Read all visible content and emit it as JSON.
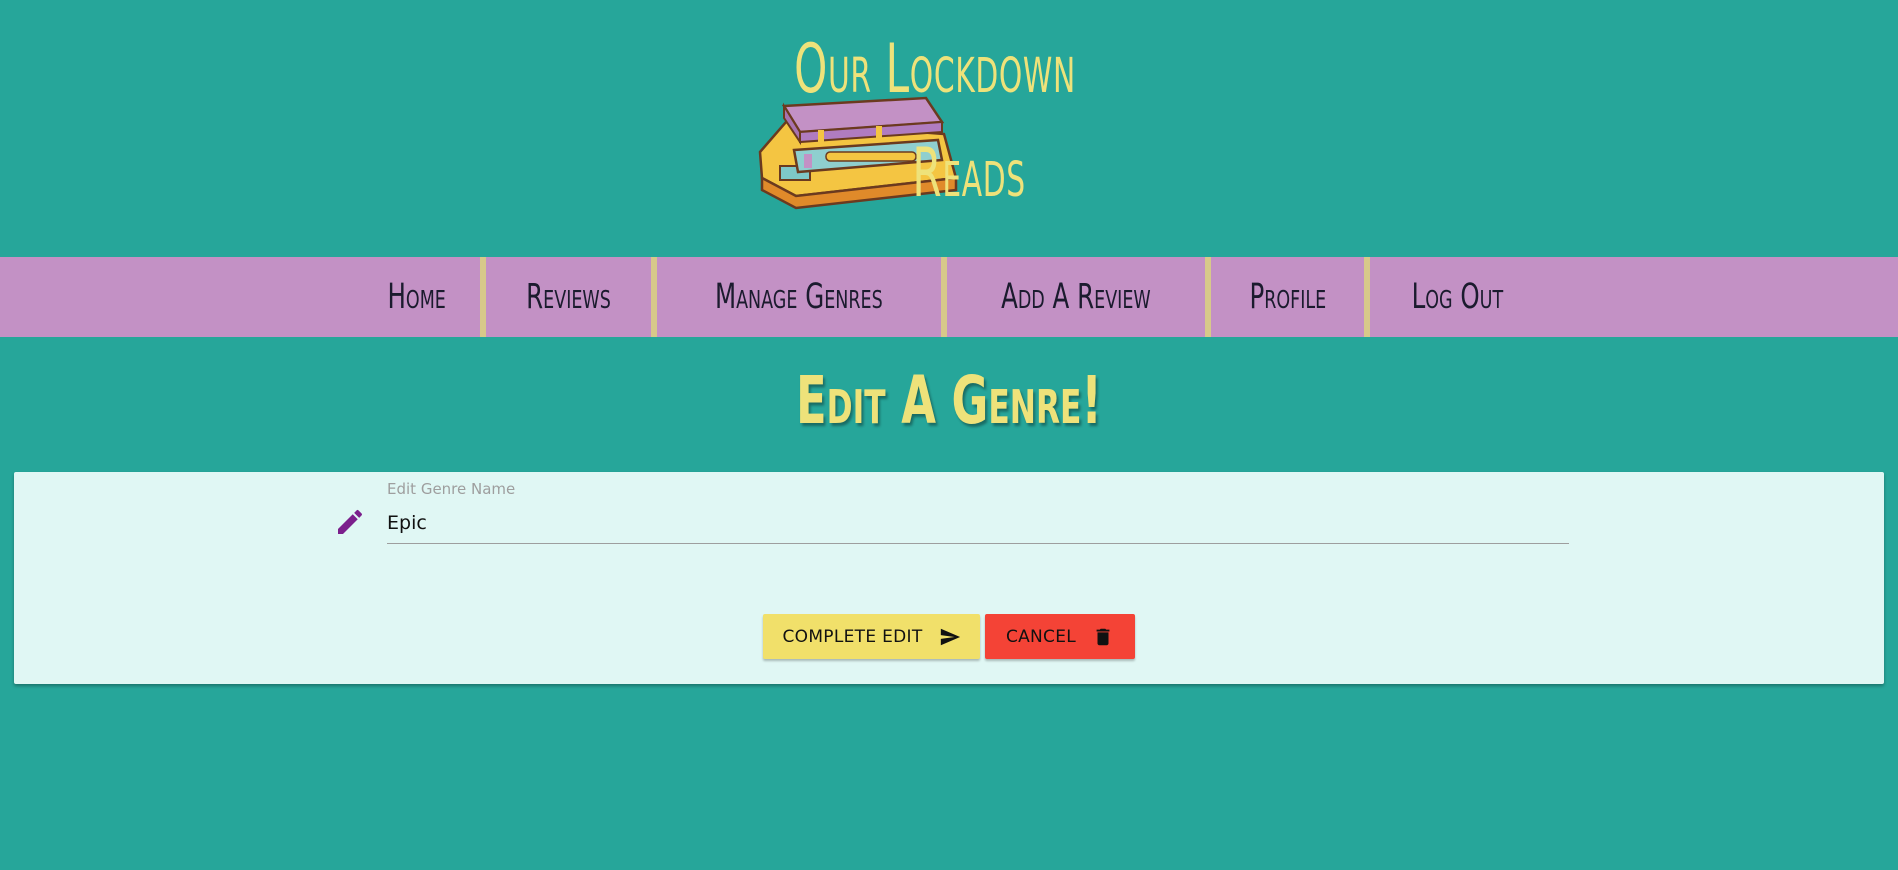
{
  "header": {
    "title_line1": "Our Lockdown",
    "title_line2": "Reads",
    "logo_icon": "book-stack-icon"
  },
  "nav": {
    "items": [
      {
        "label": "Home"
      },
      {
        "label": "Reviews"
      },
      {
        "label": "Manage Genres"
      },
      {
        "label": "Add A Review"
      },
      {
        "label": "Profile"
      },
      {
        "label": "Log Out"
      }
    ]
  },
  "page": {
    "heading": "Edit A Genre!"
  },
  "form": {
    "field_icon": "pencil-icon",
    "field_label": "Edit Genre Name",
    "field_value": "Epic",
    "complete_label": "COMPLETE EDIT",
    "complete_icon": "send-icon",
    "cancel_label": "CANCEL",
    "cancel_icon": "trash-icon"
  },
  "colors": {
    "background": "#26a69a",
    "nav_background": "#c391c5",
    "title_color": "#eee27a",
    "card_background": "#e0f7f4",
    "complete_button": "#f1e06a",
    "cancel_button": "#f44336",
    "icon_purple": "#7b1f8c"
  }
}
